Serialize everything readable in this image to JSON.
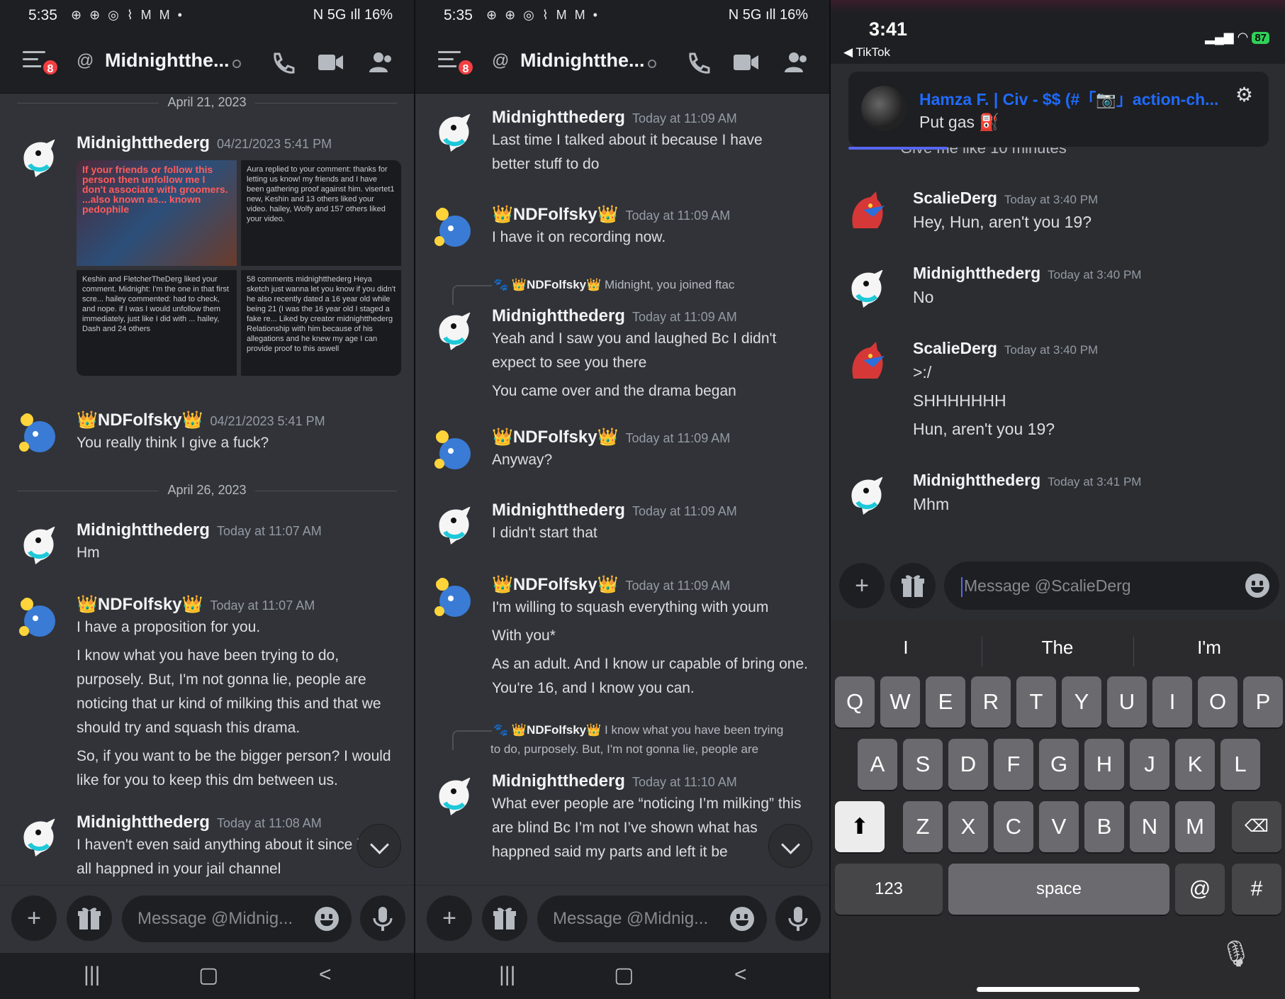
{
  "p1": {
    "status": {
      "time": "5:35",
      "left_icons": "⊕ ⊕ ◎ ⌇ M M •",
      "right": "N 5G ıll 16%"
    },
    "header": {
      "badge": "8",
      "at": "@",
      "title": "Midnightthe..."
    },
    "date1": "April 21, 2023",
    "m1": {
      "author": "Midnightthederg",
      "ts": "04/21/2023 5:41 PM"
    },
    "shots": [
      "If your friends or follow this person then unfollow me I don't associate with groomers. ...also known as... known pedophile",
      "Aura replied to your comment: thanks for letting us know! my friends and I have been gathering proof against him. visertet1 new, Keshin and 13 others liked your video. hailey, Wolfy and 157 others liked your video.",
      "Keshin and FletcherTheDerg liked your comment. Midnight: I'm the one in that first scre... hailey commented: had to check, and nope. if I was I would unfollow them immediately, just like I did with ... hailey, Dash and 24 others",
      "58 comments  midnightthederg  Heya sketch just wanna let you know if you didn't he also recently dated a 16 year old while being 21 (I was the 16 year old I staged a fake re...  Liked by creator  midnightthederg  Relationship with him because of his allegations and he knew my age I can provide proof to this aswell"
    ],
    "m2": {
      "author": "👑NDFolfsky👑",
      "ts": "04/21/2023 5:41 PM",
      "lines": [
        "You really think I give a fuck?"
      ]
    },
    "date2": "April 26, 2023",
    "m3": {
      "author": "Midnightthederg",
      "ts": "Today at 11:07 AM",
      "lines": [
        "Hm"
      ]
    },
    "m4": {
      "author": "👑NDFolfsky👑",
      "ts": "Today at 11:07 AM",
      "l1": "I have a proposition for you.",
      "l2": "I know what you have been trying to do,",
      "l3": "purposely.  But, I'm not gonna lie, people are",
      "l4": "noticing that ur kind of milking this and that we",
      "l5": "should try and squash this drama.",
      "l6": "So, if you want to be the bigger person? I would",
      "l7": "like for you to keep this dm between us."
    },
    "m5": {
      "author": "Midnightthederg",
      "ts": "Today at 11:08 AM",
      "l1": "I haven't even said anything about it since it",
      "l2": "all happned in your jail channel"
    },
    "composer": {
      "placeholder": "Message @Midnig...",
      "plus": "+"
    }
  },
  "p2": {
    "status": {
      "time": "5:35",
      "left_icons": "⊕ ⊕ ◎ ⌇ M M •",
      "right": "N 5G ıll 16%"
    },
    "header": {
      "badge": "8",
      "at": "@",
      "title": "Midnightthe..."
    },
    "m1": {
      "author": "Midnightthederg",
      "ts": "Today at 11:09 AM",
      "l1": "Last time I talked about it because I have",
      "l2": "better stuff to do"
    },
    "m2": {
      "author": "👑NDFolfsky👑",
      "ts": "Today at 11:09 AM",
      "l1": "I have it on recording now."
    },
    "r1": {
      "name": "👑NDFolfsky👑",
      "text": "Midnight, you joined ftac"
    },
    "m3": {
      "author": "Midnightthederg",
      "ts": "Today at 11:09 AM",
      "l1": "Yeah and I saw you and laughed Bc I didn't",
      "l2": "expect to see you there",
      "l3": "You came over and the drama began"
    },
    "m4": {
      "author": "👑NDFolfsky👑",
      "ts": "Today at 11:09 AM",
      "l1": "Anyway?"
    },
    "m5": {
      "author": "Midnightthederg",
      "ts": "Today at 11:09 AM",
      "l1": "I didn't start that"
    },
    "m6": {
      "author": "👑NDFolfsky👑",
      "ts": "Today at 11:09 AM",
      "l1": "I'm willing to squash everything with youm",
      "l2": "With you*",
      "l3": "As an adult. And I know ur capable of bring one.",
      "l4": "You're 16, and I know you can."
    },
    "r2": {
      "name": "👑NDFolfsky👑",
      "text": "I know what you have been trying",
      "text2": "to do, purposely.  But, I'm not gonna lie, people are"
    },
    "m7": {
      "author": "Midnightthederg",
      "ts": "Today at 11:10 AM",
      "l1": "What ever people are “noticing I’m milking” this",
      "l2": "are blind Bc I’m not I’ve shown what has",
      "l3": "happned said my parts and left it be"
    },
    "composer": {
      "placeholder": "Message @Midnig...",
      "plus": "+"
    }
  },
  "p3": {
    "status": {
      "time": "3:41",
      "back": "◀ TikTok",
      "battery": "87"
    },
    "notif": {
      "title": "Hamza F. | Civ - $$ (#「📷」action-ch...",
      "body": "Put gas ⛽"
    },
    "cut": "Give me like 10 minutes",
    "m1": {
      "author": "ScalieDerg",
      "ts": "Today at 3:40 PM",
      "l1": "Hey, Hun, aren't you 19?"
    },
    "m2": {
      "author": "Midnightthederg",
      "ts": "Today at 3:40 PM",
      "l1": "No"
    },
    "m3": {
      "author": "ScalieDerg",
      "ts": "Today at 3:40 PM",
      "l1": ">:/",
      "l2": "SHHHHHHH",
      "l3": "Hun, aren't you 19?"
    },
    "m4": {
      "author": "Midnightthederg",
      "ts": "Today at 3:41 PM",
      "l1": "Mhm"
    },
    "composer": {
      "placeholder": "Message @ScalieDerg",
      "plus": "+"
    },
    "suggestions": [
      "I",
      "The",
      "I'm"
    ],
    "row1": [
      "Q",
      "W",
      "E",
      "R",
      "T",
      "Y",
      "U",
      "I",
      "O",
      "P"
    ],
    "row2": [
      "A",
      "S",
      "D",
      "F",
      "G",
      "H",
      "J",
      "K",
      "L"
    ],
    "row3": [
      "Z",
      "X",
      "C",
      "V",
      "B",
      "N",
      "M"
    ],
    "numkey": "123",
    "space": "space",
    "at": "@",
    "hash": "#"
  }
}
